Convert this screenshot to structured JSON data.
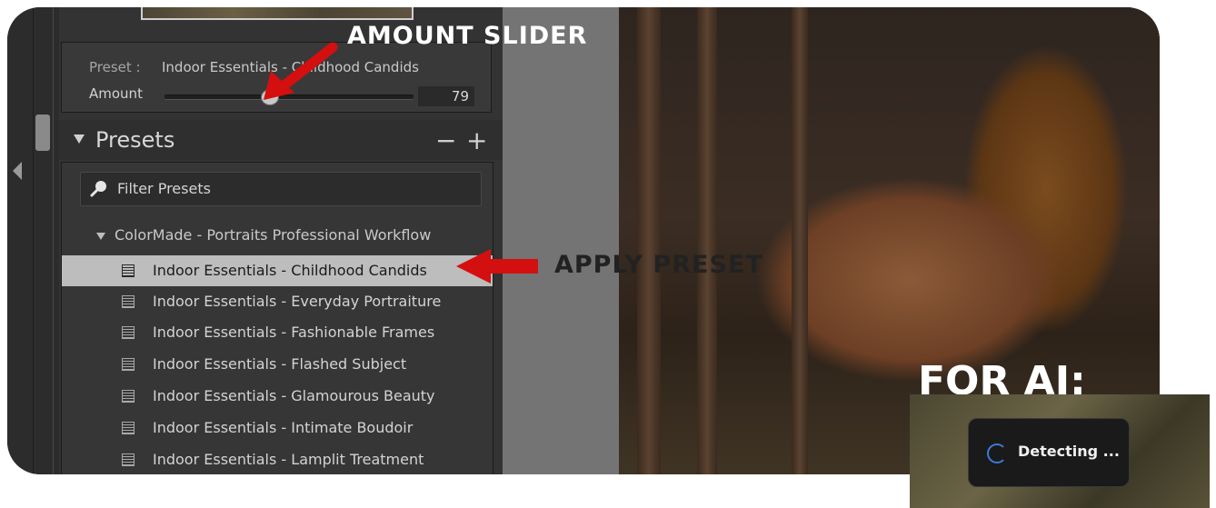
{
  "sidebar": {
    "preset_label": "Preset :",
    "preset_value": "Indoor Essentials - Childhood Candids",
    "amount_label": "Amount",
    "amount_value": "79",
    "amount_fraction": 0.42
  },
  "presets_panel": {
    "title": "Presets",
    "remove_label": "−",
    "add_label": "+",
    "filter_placeholder": "Filter Presets",
    "group_name": "ColorMade - Portraits Professional Workflow",
    "items": [
      {
        "label": "Indoor Essentials - Childhood Candids",
        "selected": true
      },
      {
        "label": "Indoor Essentials - Everyday Portraiture",
        "selected": false
      },
      {
        "label": "Indoor Essentials - Fashionable Frames",
        "selected": false
      },
      {
        "label": "Indoor Essentials - Flashed Subject",
        "selected": false
      },
      {
        "label": "Indoor Essentials - Glamourous Beauty",
        "selected": false
      },
      {
        "label": "Indoor Essentials - Intimate Boudoir",
        "selected": false
      },
      {
        "label": "Indoor Essentials - Lamplit Treatment",
        "selected": false
      }
    ]
  },
  "annotations": {
    "amount_slider": "AMOUNT SLIDER",
    "apply_preset": "APPLY PRESET",
    "for_ai": "FOR AI:"
  },
  "ai_badge": {
    "status_text": "Detecting ..."
  },
  "colors": {
    "arrow": "#d40f0f",
    "selection": "#bdbdbd",
    "spinner": "#3d7ad6"
  }
}
